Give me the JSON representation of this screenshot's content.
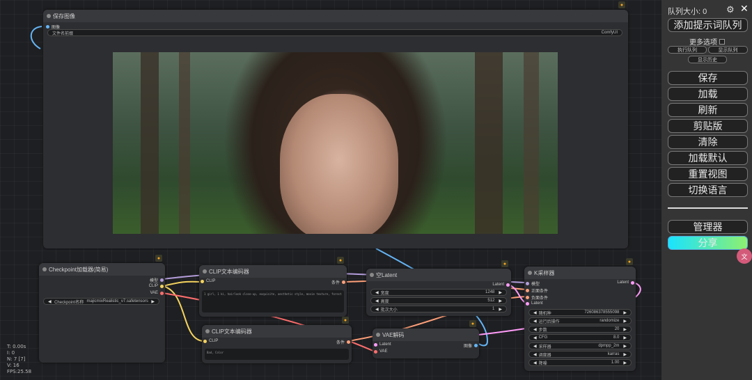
{
  "colors": {
    "canvas_bg": "#1e1f22",
    "node_bg": "#2d2e31",
    "node_title_bg": "#38393d",
    "link_model": "#b39ddb",
    "link_clip": "#f4d35e",
    "link_vae": "#ff6e6e",
    "link_conditioning": "#ffa07a",
    "link_latent": "#ff9cf9",
    "link_image": "#64b5f6",
    "share_gradient": [
      "#19e3ff",
      "#8ef06f"
    ]
  },
  "save_image": {
    "title": "保存图像",
    "input_label": "图像",
    "filename_label": "文件名前缀",
    "filename_value": "ComfyUI",
    "image_alt_icon": "generated-portrait-forest"
  },
  "checkpoint": {
    "title": "Checkpoint加载器(简易)",
    "outputs": [
      "模型",
      "CLIP",
      "VAE"
    ],
    "ckpt_label": "Checkpoint名称",
    "ckpt_value": "majicmixRealistic_v7.safetensors"
  },
  "clip_pos": {
    "title": "CLIP文本编码器",
    "input": "CLIP",
    "output": "条件",
    "text": "1 girl, 1 ki, hairlook close-up, exquisite, aesthetic style, movie texture, forest"
  },
  "clip_neg": {
    "title": "CLIP文本编码器",
    "input": "CLIP",
    "output": "条件",
    "text": "Bad, Color"
  },
  "empty_latent": {
    "title": "空Latent",
    "output": "Latent",
    "fields": [
      {
        "label": "宽度",
        "value": "1248"
      },
      {
        "label": "高度",
        "value": "512"
      },
      {
        "label": "批次大小",
        "value": "1"
      }
    ]
  },
  "vae_decode": {
    "title": "VAE解码",
    "inputs": [
      "Latent",
      "VAE"
    ],
    "output": "图像"
  },
  "ksampler": {
    "title": "K采样器",
    "inputs": [
      "模型",
      "正面条件",
      "负面条件",
      "Latent"
    ],
    "output": "Latent",
    "fields": [
      {
        "label": "随机种",
        "value": "726086378555098"
      },
      {
        "label": "运行后操作",
        "value": "randomize"
      },
      {
        "label": "步数",
        "value": "20"
      },
      {
        "label": "CFG",
        "value": "8.0"
      },
      {
        "label": "采样器",
        "value": "dpmpp_2m"
      },
      {
        "label": "调度器",
        "value": "karras"
      },
      {
        "label": "降噪",
        "value": "1.00"
      }
    ]
  },
  "menu": {
    "queue_size": "队列大小: 0",
    "settings_icon": "gear-icon",
    "close_icon": "close-icon",
    "queue_prompt": "添加提示词队列",
    "extra_options": "更多选项",
    "view_queue": "执行队列",
    "show_queue": "显示队列",
    "view_history": "显示历史",
    "buttons": [
      "保存",
      "加载",
      "刷新",
      "剪贴版",
      "清除",
      "加载默认",
      "重置视图",
      "切换语言"
    ],
    "manager": "管理器",
    "share": "分享"
  },
  "stats": {
    "t": "T: 0.00s",
    "i": "I: 0",
    "n": "N: 7 [7]",
    "v": "V: 16",
    "fps": "FPS:25.58"
  }
}
